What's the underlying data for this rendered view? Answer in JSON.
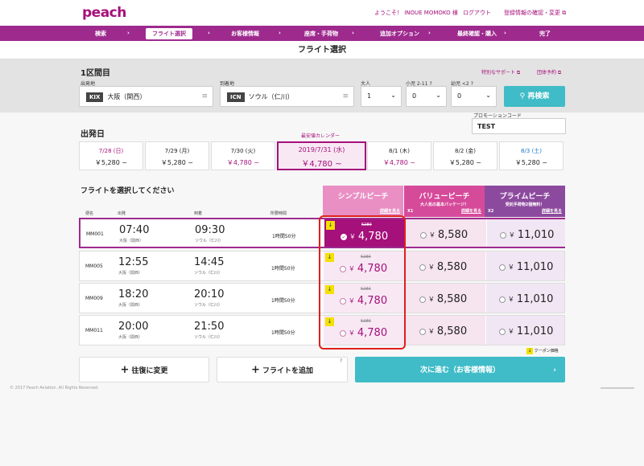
{
  "header": {
    "logo": "peach",
    "welcome": "ようこそ！ INOUE MOMOKO 様",
    "logout": "ログアウト",
    "profile": "登録情報の確認・変更"
  },
  "steps": [
    "検索",
    "フライト選択",
    "お客様情報",
    "座席・手荷物",
    "追加オプション",
    "最終確認・購入",
    "完了"
  ],
  "page_title": "フライト選択",
  "search": {
    "section": "1区間目",
    "special": "特別なサポート",
    "group": "団体予約",
    "from_label": "出発地",
    "from_code": "KIX",
    "from_name": "大阪（関西）",
    "to_label": "到着地",
    "to_code": "ICN",
    "to_name": "ソウル（仁川）",
    "adult_label": "大人",
    "adult_value": "1",
    "child_label": "小児 2-11",
    "child_value": "0",
    "infant_label": "幼児 <2",
    "infant_value": "0",
    "research": "再検索",
    "promo_label": "プロモーションコード",
    "promo_value": "TEST"
  },
  "dates": {
    "section": "出発日",
    "cal_label": "最安値カレンダー",
    "cards": [
      {
        "date": "7/28 (日)",
        "price": "￥5,280 ~",
        "date_color": "#a5107a",
        "price_color": "#222"
      },
      {
        "date": "7/29 (月)",
        "price": "￥5,280 ~",
        "date_color": "#222",
        "price_color": "#222"
      },
      {
        "date": "7/30 (火)",
        "price": "￥4,780 ~",
        "date_color": "#222",
        "price_color": "#a5107a"
      },
      {
        "date": "2019/7/31 (水)",
        "price": "￥4,780 ~",
        "date_color": "#a5107a",
        "price_color": "#a5107a"
      },
      {
        "date": "8/1 (木)",
        "price": "￥4,780 ~",
        "date_color": "#222",
        "price_color": "#a5107a"
      },
      {
        "date": "8/2 (金)",
        "price": "￥5,280 ~",
        "date_color": "#222",
        "price_color": "#222"
      },
      {
        "date": "8/3 (土)",
        "price": "￥5,280 ~",
        "date_color": "#1a73c8",
        "price_color": "#222"
      }
    ]
  },
  "flights": {
    "section": "フライトを選択してください",
    "col_flight": "便名",
    "col_dep": "出発",
    "col_arr": "到着",
    "col_dur": "所要時間",
    "fares": [
      {
        "name": "シンプルピーチ",
        "sub": "",
        "detail": "詳細を見る",
        "color": "#e98fc4"
      },
      {
        "name": "バリューピーチ",
        "sub": "大人気の基本パッケージ！",
        "extra": "X1",
        "detail": "詳細を見る",
        "color": "#d64a9a"
      },
      {
        "name": "プライムピーチ",
        "sub": "受託手荷物2個無料！",
        "extra": "X2",
        "detail": "詳細を見る",
        "color": "#8c4a9e"
      }
    ],
    "rows": [
      {
        "no": "MM001",
        "dep": "07:40",
        "dep_ap": "大阪（関西）",
        "arr": "09:30",
        "arr_ap": "ソウル（仁川）",
        "dur": "1時間50分",
        "old": "5280",
        "simple": "4,780",
        "value": "8,580",
        "prime": "11,010"
      },
      {
        "no": "MM005",
        "dep": "12:55",
        "dep_ap": "大阪（関西）",
        "arr": "14:45",
        "arr_ap": "ソウル（仁川）",
        "dur": "1時間50分",
        "old": "5280",
        "simple": "4,780",
        "value": "8,580",
        "prime": "11,010"
      },
      {
        "no": "MM009",
        "dep": "18:20",
        "dep_ap": "大阪（関西）",
        "arr": "20:10",
        "arr_ap": "ソウル（仁川）",
        "dur": "1時間50分",
        "old": "5280",
        "simple": "4,780",
        "value": "8,580",
        "prime": "11,010"
      },
      {
        "no": "MM011",
        "dep": "20:00",
        "dep_ap": "大阪（関西）",
        "arr": "21:50",
        "arr_ap": "ソウル（仁川）",
        "dur": "1時間50分",
        "old": "5280",
        "simple": "4,780",
        "value": "8,580",
        "prime": "11,010"
      }
    ],
    "coupon_note": "クーポン価格",
    "yen": "￥"
  },
  "footer": {
    "roundtrip": "往復に変更",
    "add_flight": "フライトを追加",
    "next": "次に進む（お客様情報）",
    "copyright": "© 2017 Peach Aviation. All Rights Reserved."
  }
}
